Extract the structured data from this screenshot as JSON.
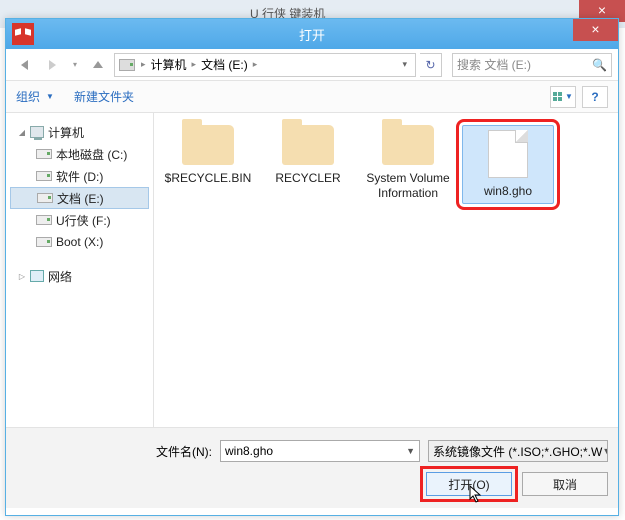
{
  "parent_window": {
    "title_fragment": "U 行侠  键装机"
  },
  "dialog": {
    "title": "打开",
    "breadcrumb": {
      "root": "计算机",
      "current": "文档 (E:)"
    },
    "search": {
      "placeholder": "搜索 文档 (E:)"
    },
    "toolbar": {
      "organize": "组织",
      "new_folder": "新建文件夹"
    }
  },
  "tree": {
    "computer": "计算机",
    "items": [
      {
        "label": "本地磁盘 (C:)"
      },
      {
        "label": "软件 (D:)"
      },
      {
        "label": "文档 (E:)"
      },
      {
        "label": "U行侠 (F:)"
      },
      {
        "label": "Boot (X:)"
      }
    ],
    "network": "网络"
  },
  "files": [
    {
      "name": "$RECYCLE.BIN",
      "kind": "folder"
    },
    {
      "name": "RECYCLER",
      "kind": "folder"
    },
    {
      "name": "System Volume Information",
      "kind": "folder"
    },
    {
      "name": "win8.gho",
      "kind": "file",
      "selected": true
    }
  ],
  "bottom": {
    "filename_label": "文件名(N):",
    "filename_value": "win8.gho",
    "filter_text": "系统镜像文件 (*.ISO;*.GHO;*.W",
    "open_button": "打开(O)",
    "cancel_button": "取消"
  }
}
